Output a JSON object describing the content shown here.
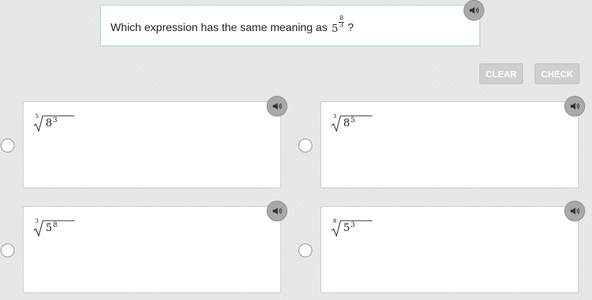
{
  "question": {
    "prefix": "Which expression has the same meaning as",
    "base": "5",
    "exp_num": "8",
    "exp_den": "3",
    "suffix": "?"
  },
  "buttons": {
    "clear": "CLEAR",
    "check": "CHECK"
  },
  "options": [
    {
      "index": "5",
      "base": "8",
      "power": "3"
    },
    {
      "index": "3",
      "base": "8",
      "power": "5"
    },
    {
      "index": "3",
      "base": "5",
      "power": "8"
    },
    {
      "index": "8",
      "base": "5",
      "power": "3"
    }
  ],
  "icons": {
    "speaker": "speaker-icon",
    "radio": "radio-circle"
  },
  "colors": {
    "question_border": "#9fd1db",
    "button_bg": "#cfcfcf",
    "speaker_bg": "#a9a9a9"
  }
}
